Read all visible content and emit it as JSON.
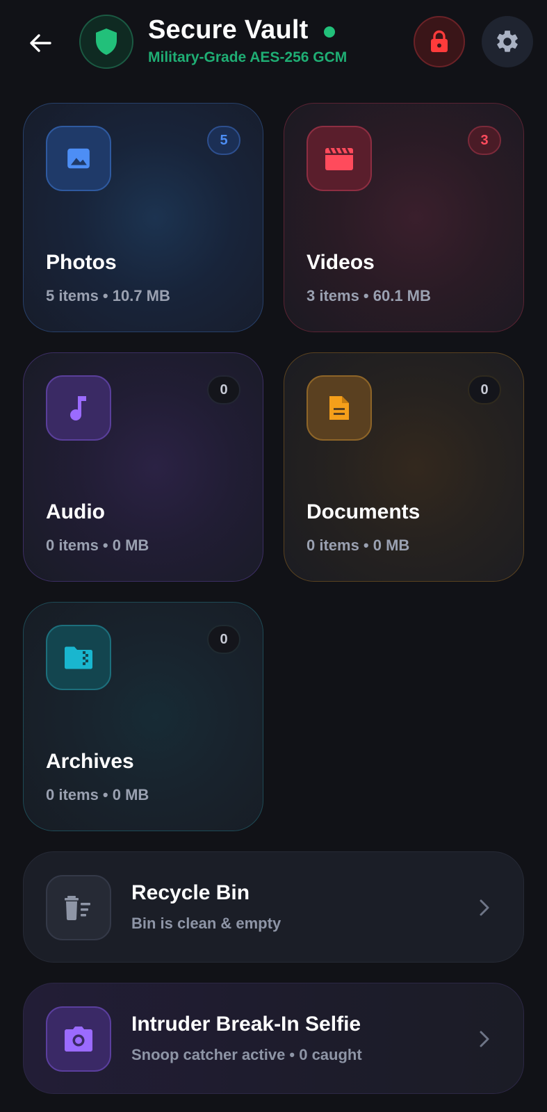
{
  "header": {
    "title": "Secure Vault",
    "subtitle": "Military-Grade AES-256 GCM",
    "icons": {
      "back": "back-arrow-icon",
      "badge": "shield-icon",
      "lock": "lock-icon",
      "settings": "gear-icon"
    }
  },
  "colors": {
    "background": "#111217",
    "accent_green": "#1fae74",
    "status_online": "#22c07a",
    "photos": "#4d8ef5",
    "videos": "#ff4b5c",
    "audio": "#9b6bff",
    "documents": "#f59f1a",
    "archives": "#19b6cf"
  },
  "categories": [
    {
      "key": "photos",
      "title": "Photos",
      "count": "5",
      "meta": "5 items • 10.7 MB",
      "icon": "image-icon"
    },
    {
      "key": "videos",
      "title": "Videos",
      "count": "3",
      "meta": "3 items • 60.1 MB",
      "icon": "clapperboard-icon"
    },
    {
      "key": "audio",
      "title": "Audio",
      "count": "0",
      "meta": "0 items • 0 MB",
      "icon": "music-note-icon"
    },
    {
      "key": "documents",
      "title": "Documents",
      "count": "0",
      "meta": "0 items • 0 MB",
      "icon": "document-icon"
    },
    {
      "key": "archives",
      "title": "Archives",
      "count": "0",
      "meta": "0 items • 0 MB",
      "icon": "zip-folder-icon"
    }
  ],
  "rows": [
    {
      "key": "recycle",
      "title": "Recycle Bin",
      "subtitle": "Bin is clean & empty",
      "icon": "trash-icon"
    },
    {
      "key": "intruder",
      "title": "Intruder Break-In Selfie",
      "subtitle": "Snoop catcher active • 0 caught",
      "icon": "camera-icon"
    }
  ]
}
